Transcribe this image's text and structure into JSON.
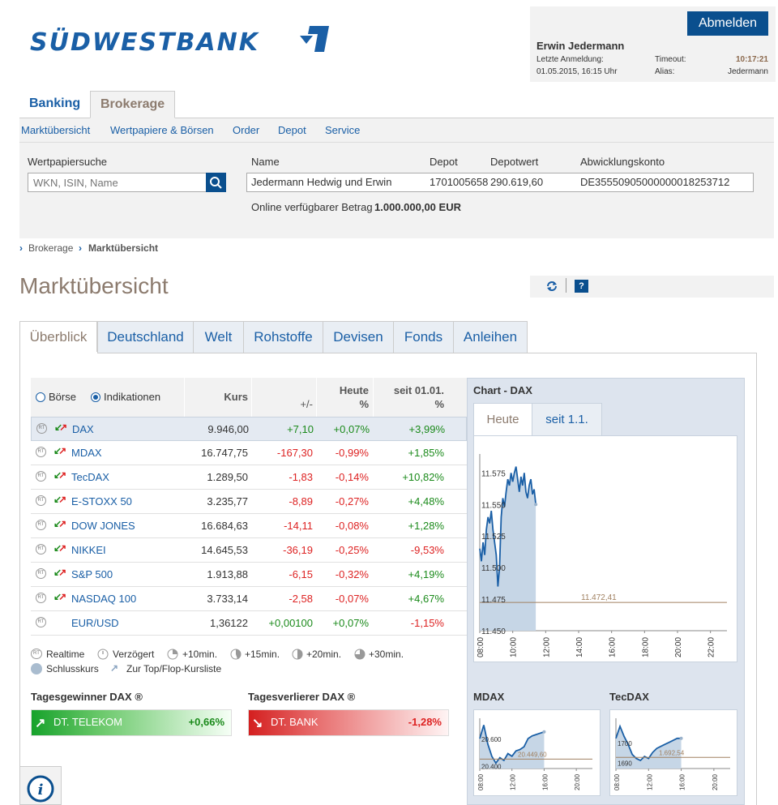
{
  "header": {
    "logo_text": "SÜDWESTBANK",
    "logout_label": "Abmelden",
    "user_name": "Erwin Jedermann",
    "last_login_label": "Letzte Anmeldung:",
    "last_login_value": "01.05.2015, 16:15 Uhr",
    "timeout_label": "Timeout:",
    "timeout_value": "10:17:21",
    "alias_label": "Alias:",
    "alias_value": "Jedermann"
  },
  "top_tabs": [
    {
      "label": "Banking"
    },
    {
      "label": "Brokerage"
    }
  ],
  "subnav": [
    "Marktübersicht",
    "Wertpapiere & Börsen",
    "Order",
    "Depot",
    "Service"
  ],
  "search": {
    "label": "Wertpapiersuche",
    "placeholder": "WKN, ISIN, Name"
  },
  "account": {
    "name_label": "Name",
    "depot_label": "Depot",
    "depotwert_label": "Depotwert",
    "konto_label": "Abwicklungskonto",
    "name": "Jedermann Hedwig und Erwin",
    "depot": "1701005658",
    "depotwert": "290.619,60",
    "konto": "DE35550905000000018253712",
    "available_label": "Online verfügbarer Betrag",
    "available_value": "1.000.000,00 EUR"
  },
  "breadcrumb": [
    "Brokerage",
    "Marktübersicht"
  ],
  "page_title": "Marktübersicht",
  "market_tabs": [
    "Überblick",
    "Deutschland",
    "Welt",
    "Rohstoffe",
    "Devisen",
    "Fonds",
    "Anleihen"
  ],
  "table": {
    "radio_boerse": "Börse",
    "radio_indikationen": "Indikationen",
    "col_kurs": "Kurs",
    "col_change": "+/-",
    "col_heute": "Heute",
    "col_heute_unit": "%",
    "col_seit": "seit 01.01.",
    "col_seit_unit": "%",
    "rt_label": "RT",
    "rows": [
      {
        "name": "DAX",
        "kurs": "9.946,00",
        "change": "+7,10",
        "heute": "+0,07%",
        "seit": "+3,99%"
      },
      {
        "name": "MDAX",
        "kurs": "16.747,75",
        "change": "-167,30",
        "heute": "-0,99%",
        "seit": "+1,85%"
      },
      {
        "name": "TecDAX",
        "kurs": "1.289,50",
        "change": "-1,83",
        "heute": "-0,14%",
        "seit": "+10,82%"
      },
      {
        "name": "E-STOXX 50",
        "kurs": "3.235,77",
        "change": "-8,89",
        "heute": "-0,27%",
        "seit": "+4,48%"
      },
      {
        "name": "DOW JONES",
        "kurs": "16.684,63",
        "change": "-14,11",
        "heute": "-0,08%",
        "seit": "+1,28%"
      },
      {
        "name": "NIKKEI",
        "kurs": "14.645,53",
        "change": "-36,19",
        "heute": "-0,25%",
        "seit": "-9,53%"
      },
      {
        "name": "S&P 500",
        "kurs": "1.913,88",
        "change": "-6,15",
        "heute": "-0,32%",
        "seit": "+4,19%"
      },
      {
        "name": "NASDAQ 100",
        "kurs": "3.733,14",
        "change": "-2,58",
        "heute": "-0,07%",
        "seit": "+4,67%"
      },
      {
        "name": "EUR/USD",
        "kurs": "1,36122",
        "change": "+0,00100",
        "heute": "+0,07%",
        "seit": "-1,15%"
      }
    ]
  },
  "legend": {
    "realtime": "Realtime",
    "verzoegert": "Verzögert",
    "m10": "+10min.",
    "m15": "+15min.",
    "m20": "+20min.",
    "m30": "+30min.",
    "schlusskurs": "Schlusskurs",
    "topflop": "Zur Top/Flop-Kursliste"
  },
  "winner": {
    "title": "Tagesgewinner DAX ®",
    "name": "DT. TELEKOM",
    "value": "+0,66%"
  },
  "loser": {
    "title": "Tagesverlierer DAX ®",
    "name": "DT. BANK",
    "value": "-1,28%"
  },
  "chart_panel": {
    "title": "Chart - DAX",
    "tab_today": "Heute",
    "tab_ytd": "seit 1.1.",
    "mdax_title": "MDAX",
    "tecdax_title": "TecDAX"
  },
  "chart_data": [
    {
      "type": "area",
      "title": "Chart - DAX",
      "x_ticks": [
        "08:00",
        "10:00",
        "12:00",
        "14:00",
        "16:00",
        "18:00",
        "20:00",
        "22:00"
      ],
      "y_ticks": [
        "11.575",
        "11.550",
        "11.525",
        "11.500",
        "11.475",
        "11.450"
      ],
      "ylim": [
        11450,
        11590
      ],
      "reference_label": "11.472,41",
      "reference_value": 11472.41,
      "x_hours": [
        8.0,
        8.1,
        8.2,
        8.3,
        8.4,
        8.5,
        8.6,
        8.7,
        8.8,
        8.9,
        9.0,
        9.1,
        9.2,
        9.3,
        9.4,
        9.5,
        9.6,
        9.7,
        9.8,
        9.9,
        10.0,
        10.1,
        10.2,
        10.3,
        10.4,
        10.5,
        10.6,
        10.7,
        10.8,
        10.9,
        11.0,
        11.1,
        11.2,
        11.3,
        11.4
      ],
      "values": [
        11515,
        11505,
        11520,
        11510,
        11530,
        11540,
        11535,
        11545,
        11530,
        11520,
        11510,
        11485,
        11500,
        11540,
        11555,
        11548,
        11560,
        11570,
        11565,
        11575,
        11568,
        11575,
        11580,
        11570,
        11560,
        11572,
        11565,
        11575,
        11560,
        11555,
        11565,
        11570,
        11558,
        11562,
        11550
      ]
    },
    {
      "type": "area",
      "title": "MDAX",
      "x_ticks": [
        "08:00",
        "12:00",
        "16:00",
        "20:00"
      ],
      "y_ticks": [
        "20.600",
        "20.400"
      ],
      "ylim": [
        20380,
        20750
      ],
      "reference_label": "20.449,60",
      "reference_value": 20449.6,
      "x_hours": [
        8,
        8.5,
        9,
        9.5,
        10,
        10.5,
        11,
        11.5,
        12,
        12.5,
        13,
        13.5,
        14,
        14.5,
        15,
        15.5,
        16
      ],
      "values": [
        20600,
        20700,
        20560,
        20470,
        20420,
        20460,
        20440,
        20490,
        20470,
        20510,
        20520,
        20540,
        20600,
        20620,
        20630,
        20640,
        20650
      ]
    },
    {
      "type": "area",
      "title": "TecDAX",
      "x_ticks": [
        "08:00",
        "12:00",
        "16:00",
        "20:00"
      ],
      "y_ticks": [
        "1700",
        "1690"
      ],
      "ylim": [
        1687,
        1712
      ],
      "reference_label": "1.692,54",
      "reference_value": 1692.54,
      "x_hours": [
        8,
        8.5,
        9,
        9.5,
        10,
        10.5,
        11,
        11.5,
        12,
        12.5,
        13,
        13.5,
        14,
        14.5,
        15,
        15.5,
        16
      ],
      "values": [
        1702,
        1708,
        1703,
        1699,
        1694,
        1692,
        1691,
        1693,
        1692,
        1695,
        1697,
        1698,
        1699,
        1700,
        1701,
        1702,
        1702
      ]
    }
  ]
}
